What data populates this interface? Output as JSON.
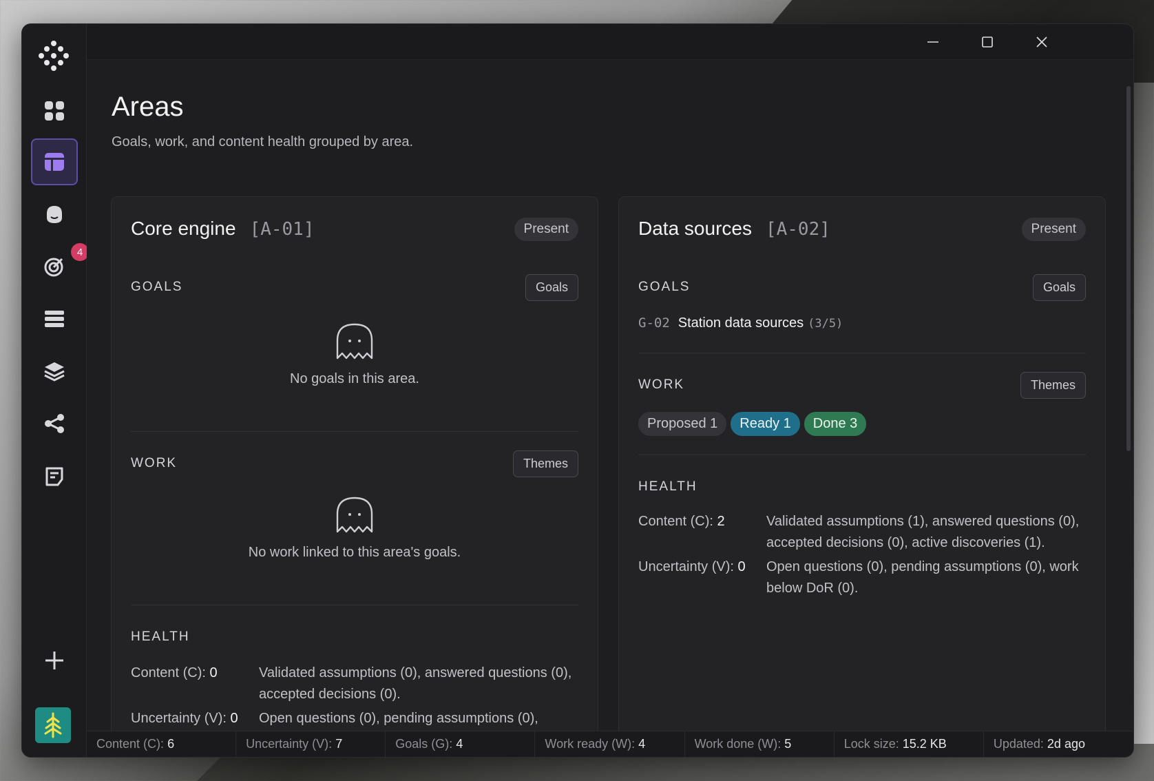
{
  "page": {
    "title": "Areas",
    "subtitle": "Goals, work, and content health grouped by area."
  },
  "sidebar": {
    "notifications_badge": "4",
    "items": [
      {
        "name": "dashboard"
      },
      {
        "name": "areas"
      },
      {
        "name": "home"
      },
      {
        "name": "goals"
      },
      {
        "name": "list"
      },
      {
        "name": "layers"
      },
      {
        "name": "share"
      },
      {
        "name": "notes"
      }
    ]
  },
  "areas": [
    {
      "title": "Core engine",
      "code": "[A-01]",
      "status": "Present",
      "goals_label": "GOALS",
      "goals_button": "Goals",
      "goals_empty": "No goals in this area.",
      "work_label": "WORK",
      "work_button": "Themes",
      "work_empty": "No work linked to this area's goals.",
      "health_label": "HEALTH",
      "content_key": "Content (C):",
      "content_val": "0",
      "content_desc": "Validated assumptions (0), answered questions (0), accepted decisions (0).",
      "uncertainty_key": "Uncertainty (V):",
      "uncertainty_val": "0",
      "uncertainty_desc": "Open questions (0), pending assumptions (0),"
    },
    {
      "title": "Data sources",
      "code": "[A-02]",
      "status": "Present",
      "goals_label": "GOALS",
      "goals_button": "Goals",
      "goal_id": "G-02",
      "goal_name": "Station data sources",
      "goal_count": "(3/5)",
      "work_label": "WORK",
      "work_button": "Themes",
      "chips": {
        "proposed": "Proposed 1",
        "ready": "Ready 1",
        "done": "Done 3"
      },
      "health_label": "HEALTH",
      "content_key": "Content (C):",
      "content_val": "2",
      "content_desc": "Validated assumptions (1), answered questions (0), accepted decisions (0), active discoveries (1).",
      "uncertainty_key": "Uncertainty (V):",
      "uncertainty_val": "0",
      "uncertainty_desc": "Open questions (0), pending assumptions (0), work below DoR (0)."
    }
  ],
  "statusbar": [
    {
      "label": "Content (C):",
      "value": "6"
    },
    {
      "label": "Uncertainty (V):",
      "value": "7"
    },
    {
      "label": "Goals (G):",
      "value": "4"
    },
    {
      "label": "Work ready (W):",
      "value": "4"
    },
    {
      "label": "Work done (W):",
      "value": "5"
    },
    {
      "label": "Lock size:",
      "value": "15.2 KB"
    },
    {
      "label": "Updated:",
      "value": "2d ago"
    }
  ]
}
